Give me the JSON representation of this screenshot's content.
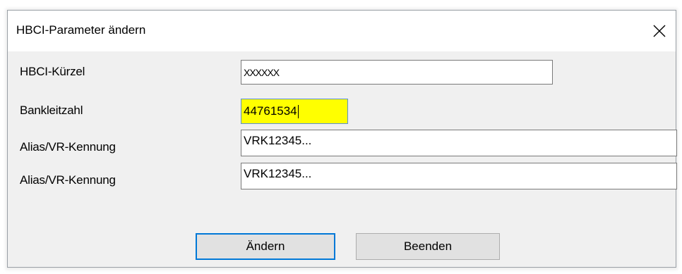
{
  "dialog": {
    "title": "HBCI-Parameter ändern",
    "close_icon": "close-icon"
  },
  "fields": [
    {
      "label": "HBCI-Kürzel",
      "value": "XXXXXX"
    },
    {
      "label": "Bankleitzahl",
      "value": "44761534"
    },
    {
      "label": "Alias/VR-Kennung",
      "value": "VRK12345..."
    },
    {
      "label": "Alias/VR-Kennung",
      "value": "VRK12345..."
    }
  ],
  "buttons": {
    "change_label": "Ändern",
    "close_label": "Beenden"
  },
  "colors": {
    "highlight": "#ffff00",
    "default_button_border": "#0078d7"
  }
}
